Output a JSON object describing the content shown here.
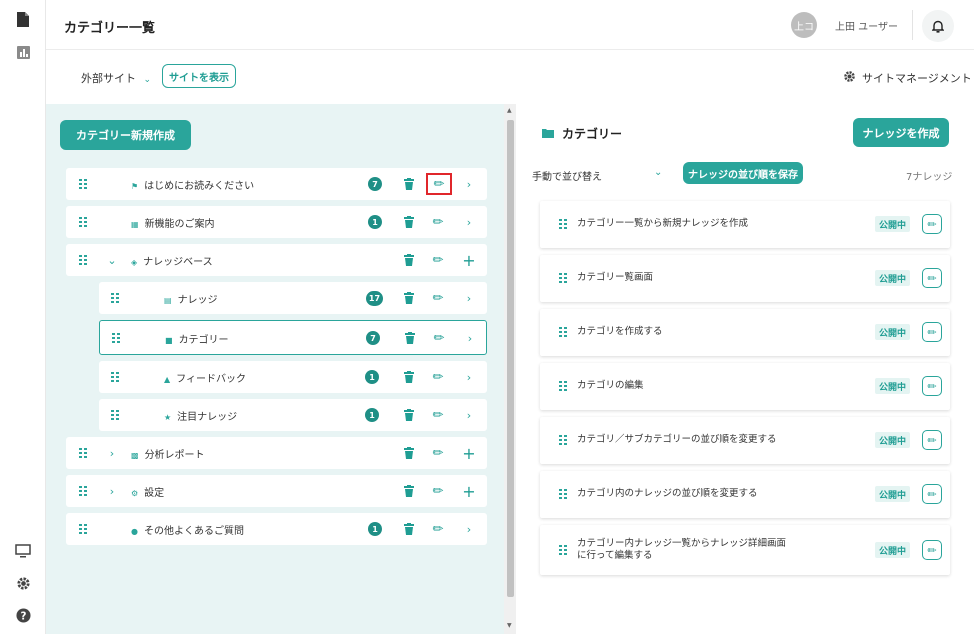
{
  "header": {
    "title": "カテゴリー一覧",
    "avatar_initials": "上コ",
    "user_name": "上田 ユーザー"
  },
  "subbar": {
    "external_site_label": "外部サイト",
    "view_site_label": "サイトを表示",
    "site_management_label": "サイトマネージメント"
  },
  "left": {
    "create_button": "カテゴリー新規作成",
    "rows": [
      {
        "label": "はじめにお読みください",
        "count": "7"
      },
      {
        "label": "新機能のご案内",
        "count": "1"
      },
      {
        "label": "ナレッジベース",
        "count": ""
      },
      {
        "label": "ナレッジ",
        "count": "17"
      },
      {
        "label": "カテゴリー",
        "count": "7"
      },
      {
        "label": "フィードバック",
        "count": "1"
      },
      {
        "label": "注目ナレッジ",
        "count": "1"
      },
      {
        "label": "分析レポート",
        "count": ""
      },
      {
        "label": "設定",
        "count": ""
      },
      {
        "label": "その他よくあるご質問",
        "count": "1"
      }
    ]
  },
  "right": {
    "title": "カテゴリー",
    "create_knowledge_button": "ナレッジを作成",
    "sort_label": "手動で並び替え",
    "save_order_button": "ナレッジの並び順を保存",
    "knowledge_count": "7ナレッジ",
    "items": [
      {
        "title": "カテゴリー一覧から新規ナレッジを作成",
        "status": "公開中"
      },
      {
        "title": "カテゴリー覧画面",
        "status": "公開中"
      },
      {
        "title": "カテゴリを作成する",
        "status": "公開中"
      },
      {
        "title": "カテゴリの編集",
        "status": "公開中"
      },
      {
        "title": "カテゴリ／サブカテゴリーの並び順を変更する",
        "status": "公開中"
      },
      {
        "title": "カテゴリ内のナレッジの並び順を変更する",
        "status": "公開中"
      },
      {
        "title": "カテゴリー内ナレッジ一覧からナレッジ詳細画面に行って編集する",
        "status": "公開中"
      }
    ]
  }
}
